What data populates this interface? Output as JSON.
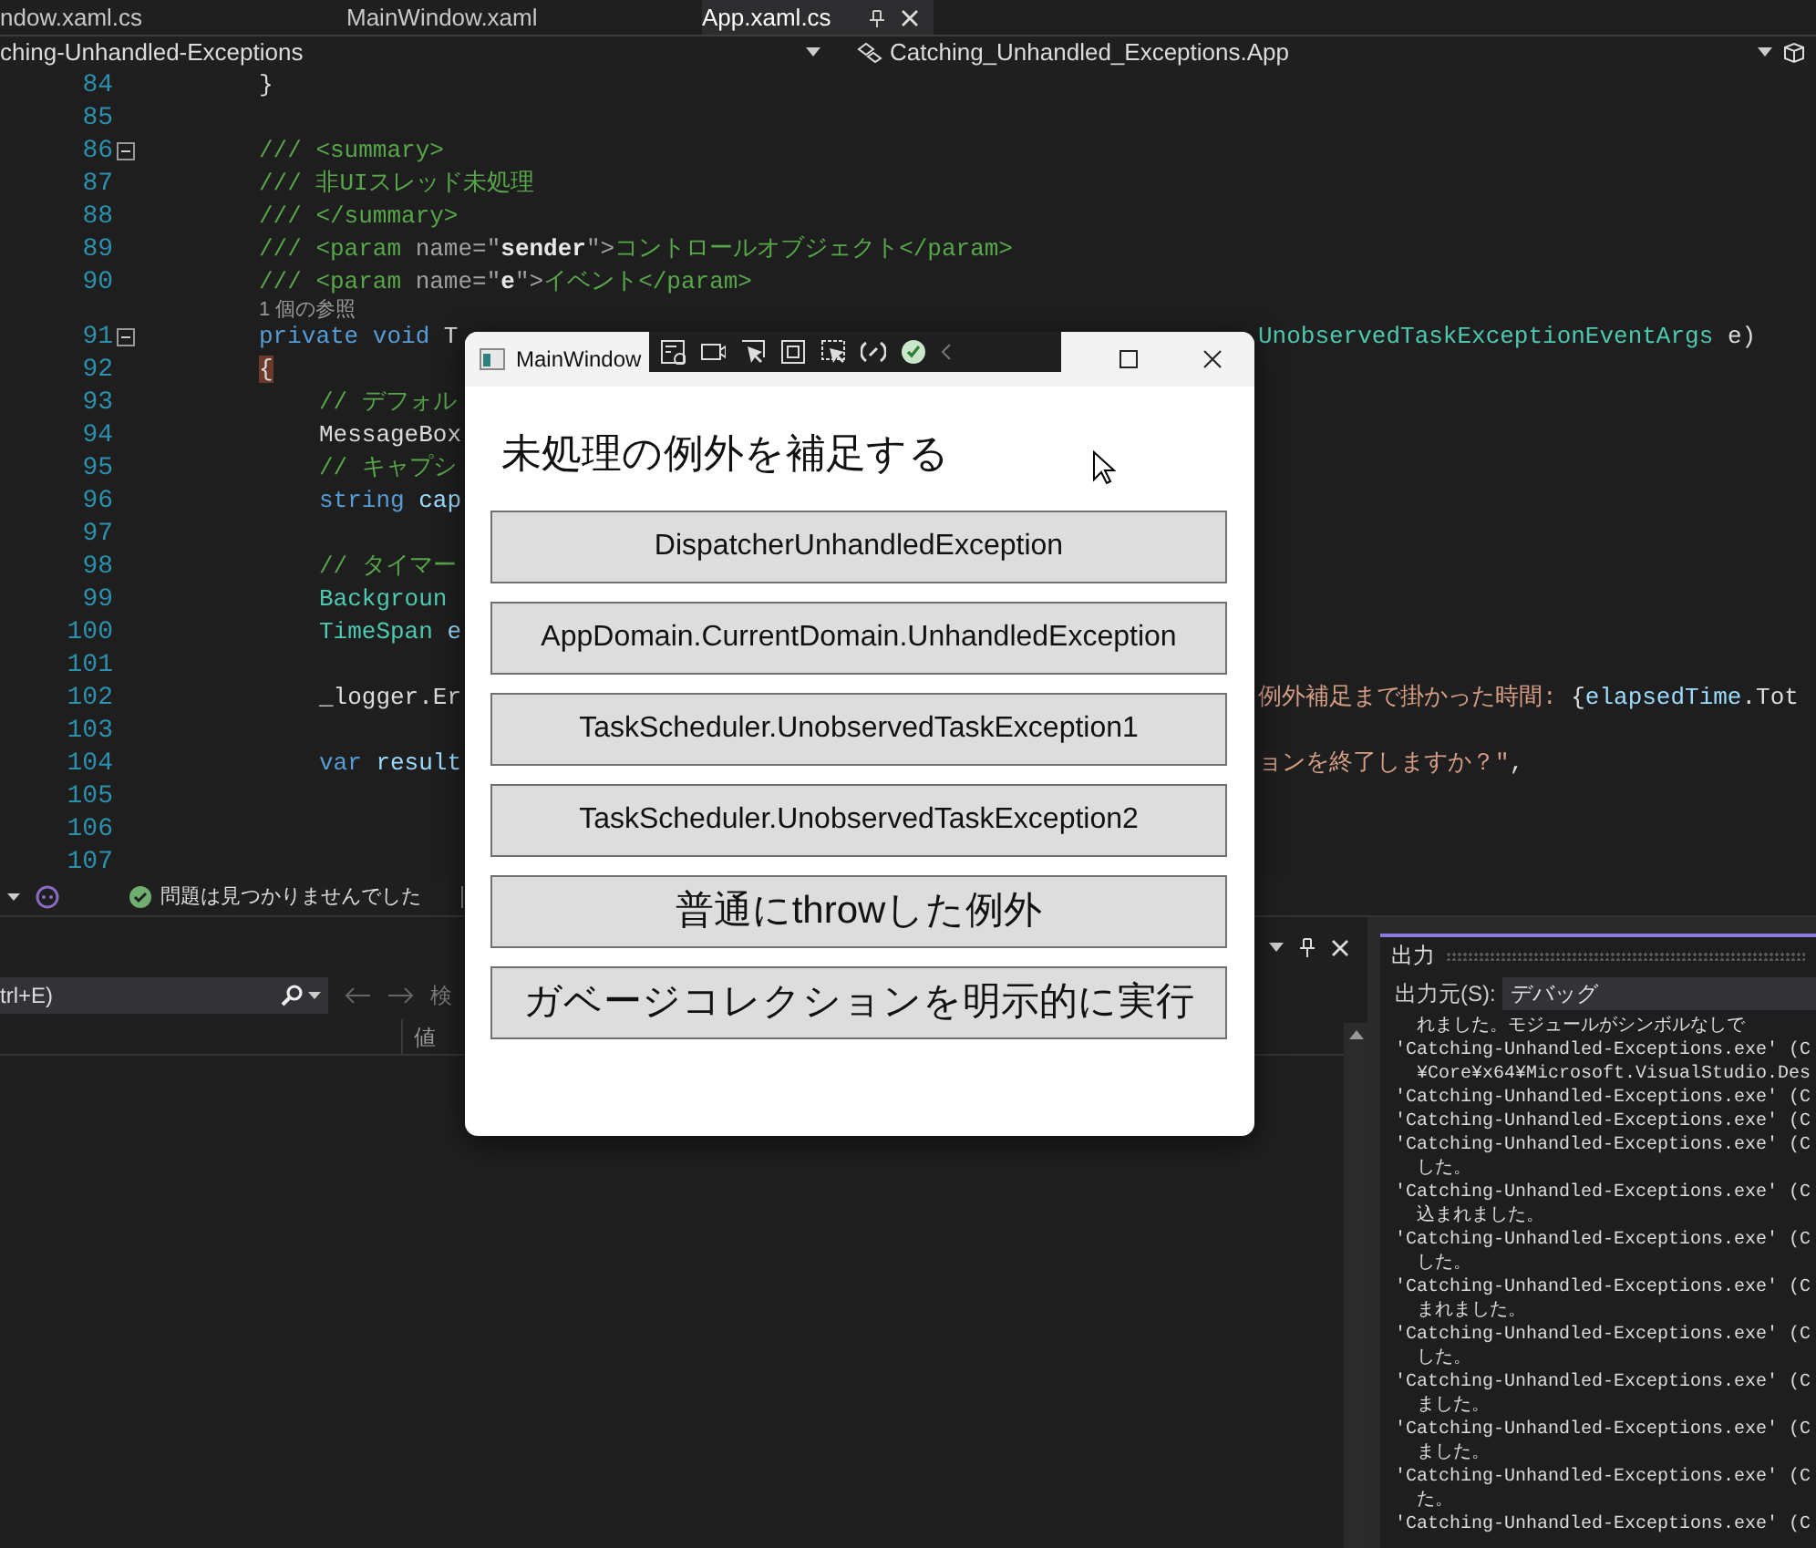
{
  "editor_tabs": [
    {
      "label": "ndow.xaml.cs",
      "selected": false
    },
    {
      "label": "MainWindow.xaml",
      "selected": false
    },
    {
      "label": "App.xaml.cs",
      "selected": true
    }
  ],
  "nav_bar": {
    "project": "ching-Unhandled-Exceptions",
    "member": "Catching_Unhandled_Exceptions.App"
  },
  "code_lines": [
    {
      "kind": "code",
      "number": "84",
      "foldable": false,
      "in_body": false,
      "left": [
        {
          "t": "}",
          "kind": "plain"
        }
      ]
    },
    {
      "kind": "code",
      "number": "85",
      "foldable": false
    },
    {
      "kind": "code",
      "number": "86",
      "foldable": true,
      "in_body": false,
      "left": [
        {
          "t": "/// <summary>",
          "kind": "comment"
        }
      ]
    },
    {
      "kind": "code",
      "number": "87",
      "foldable": false,
      "in_body": false,
      "left": [
        {
          "t": "/// 非UIスレッド未処理",
          "kind": "comment"
        }
      ]
    },
    {
      "kind": "code",
      "number": "88",
      "foldable": false,
      "in_body": false,
      "left": [
        {
          "t": "/// </summary>",
          "kind": "comment"
        }
      ]
    },
    {
      "kind": "code",
      "number": "89",
      "foldable": false,
      "in_body": false,
      "left": [
        {
          "t": "/// <param ",
          "kind": "comment"
        },
        {
          "t": "name=\"",
          "kind": "doc_attr"
        },
        {
          "t": "sender",
          "kind": "doc_value"
        },
        {
          "t": "\">",
          "kind": "doc_attr"
        },
        {
          "t": "コントロールオブジェクト</param>",
          "kind": "comment"
        }
      ]
    },
    {
      "kind": "code",
      "number": "90",
      "foldable": false,
      "in_body": false,
      "left": [
        {
          "t": "/// <param ",
          "kind": "comment"
        },
        {
          "t": "name=\"",
          "kind": "doc_attr"
        },
        {
          "t": "e",
          "kind": "doc_value"
        },
        {
          "t": "\">",
          "kind": "doc_attr"
        },
        {
          "t": "イベント</param>",
          "kind": "comment"
        }
      ]
    },
    {
      "kind": "lens",
      "text": "1 個の参照"
    },
    {
      "kind": "code",
      "number": "91",
      "foldable": true,
      "in_body": false,
      "left": [
        {
          "t": "private void ",
          "kind": "keyword"
        },
        {
          "t": "T",
          "kind": "plain"
        }
      ],
      "right": [
        {
          "t": "UnobservedTaskExceptionEventArgs",
          "kind": "type"
        },
        {
          "t": " e)",
          "kind": "plain"
        }
      ]
    },
    {
      "kind": "code",
      "number": "92",
      "foldable": false,
      "in_body": false,
      "left": [
        {
          "t": "{",
          "kind": "brace_match"
        }
      ]
    },
    {
      "kind": "code",
      "number": "93",
      "foldable": false,
      "in_body": true,
      "left": [
        {
          "t": "// デフォル",
          "kind": "comment"
        }
      ]
    },
    {
      "kind": "code",
      "number": "94",
      "foldable": false,
      "in_body": true,
      "left": [
        {
          "t": "MessageBox",
          "kind": "plain"
        }
      ]
    },
    {
      "kind": "code",
      "number": "95",
      "foldable": false,
      "in_body": true,
      "left": [
        {
          "t": "// キャプシ",
          "kind": "comment"
        }
      ]
    },
    {
      "kind": "code",
      "number": "96",
      "foldable": false,
      "in_body": true,
      "left": [
        {
          "t": "string",
          "kind": "keyword"
        },
        {
          "t": " cap",
          "kind": "ident"
        }
      ]
    },
    {
      "kind": "code",
      "number": "97",
      "foldable": false
    },
    {
      "kind": "code",
      "number": "98",
      "foldable": false,
      "in_body": true,
      "left": [
        {
          "t": "// タイマー",
          "kind": "comment"
        }
      ]
    },
    {
      "kind": "code",
      "number": "99",
      "foldable": false,
      "in_body": true,
      "left": [
        {
          "t": "Backgroun",
          "kind": "type"
        }
      ]
    },
    {
      "kind": "code",
      "number": "100",
      "foldable": false,
      "in_body": true,
      "left": [
        {
          "t": "TimeSpan",
          "kind": "type"
        },
        {
          "t": " e",
          "kind": "ident"
        }
      ]
    },
    {
      "kind": "code",
      "number": "101",
      "foldable": false
    },
    {
      "kind": "code",
      "number": "102",
      "foldable": false,
      "in_body": true,
      "left": [
        {
          "t": "_logger.Er",
          "kind": "plain"
        }
      ],
      "right": [
        {
          "t": "例外補足まで掛かった時間: ",
          "kind": "string"
        },
        {
          "t": "{",
          "kind": "plain"
        },
        {
          "t": "elapsedTime",
          "kind": "ident"
        },
        {
          "t": ".Tot",
          "kind": "plain"
        }
      ]
    },
    {
      "kind": "code",
      "number": "103",
      "foldable": false
    },
    {
      "kind": "code",
      "number": "104",
      "foldable": false,
      "in_body": true,
      "left": [
        {
          "t": "var",
          "kind": "keyword"
        },
        {
          "t": " result",
          "kind": "ident"
        }
      ],
      "right": [
        {
          "t": "ョンを終了しますか？\"",
          "kind": "string"
        },
        {
          "t": ",",
          "kind": "plain"
        }
      ]
    },
    {
      "kind": "code",
      "number": "105",
      "foldable": false
    },
    {
      "kind": "code",
      "number": "106",
      "foldable": false
    },
    {
      "kind": "code",
      "number": "107",
      "foldable": false
    }
  ],
  "status_row": {
    "message": "問題は見つかりませんでした"
  },
  "left_panel": {
    "search_placeholder": "trl+E)",
    "search_label": "検",
    "column_header": "値"
  },
  "output_panel": {
    "title": "出力",
    "source_label": "出力元(S):",
    "source": "デバッグ",
    "lines": [
      {
        "text": "れました。モジュールがシンボルなしで",
        "wrapped": true
      },
      {
        "text": "'Catching-Unhandled-Exceptions.exe' (C",
        "wrapped": false
      },
      {
        "text": "¥Core¥x64¥Microsoft.VisualStudio.Des",
        "wrapped": true
      },
      {
        "text": "'Catching-Unhandled-Exceptions.exe' (C",
        "wrapped": false
      },
      {
        "text": "'Catching-Unhandled-Exceptions.exe' (C",
        "wrapped": false
      },
      {
        "text": "'Catching-Unhandled-Exceptions.exe' (C",
        "wrapped": false
      },
      {
        "text": "した。",
        "wrapped": true
      },
      {
        "text": "'Catching-Unhandled-Exceptions.exe' (C",
        "wrapped": false
      },
      {
        "text": "込まれました。",
        "wrapped": true
      },
      {
        "text": "'Catching-Unhandled-Exceptions.exe' (C",
        "wrapped": false
      },
      {
        "text": "した。",
        "wrapped": true
      },
      {
        "text": "'Catching-Unhandled-Exceptions.exe' (C",
        "wrapped": false
      },
      {
        "text": "まれました。",
        "wrapped": true
      },
      {
        "text": "'Catching-Unhandled-Exceptions.exe' (C",
        "wrapped": false
      },
      {
        "text": "した。",
        "wrapped": true
      },
      {
        "text": "'Catching-Unhandled-Exceptions.exe' (C",
        "wrapped": false
      },
      {
        "text": "ました。",
        "wrapped": true
      },
      {
        "text": "'Catching-Unhandled-Exceptions.exe' (C",
        "wrapped": false
      },
      {
        "text": "ました。",
        "wrapped": true
      },
      {
        "text": "'Catching-Unhandled-Exceptions.exe' (C",
        "wrapped": false
      },
      {
        "text": "た。",
        "wrapped": true
      },
      {
        "text": "'Catching-Unhandled-Exceptions.exe' (C",
        "wrapped": false
      }
    ]
  },
  "app_window": {
    "title": "MainWindow",
    "heading": "未処理の例外を補足する",
    "buttons": [
      {
        "label": "DispatcherUnhandledException",
        "large_text": false
      },
      {
        "label": "AppDomain.CurrentDomain.UnhandledException",
        "large_text": false
      },
      {
        "label": "TaskScheduler.UnobservedTaskException1",
        "large_text": false
      },
      {
        "label": "TaskScheduler.UnobservedTaskException2",
        "large_text": false
      },
      {
        "label": "普通にthrowした例外",
        "large_text": true
      },
      {
        "label": "ガベージコレクションを明示的に実行",
        "large_text": true
      }
    ]
  }
}
